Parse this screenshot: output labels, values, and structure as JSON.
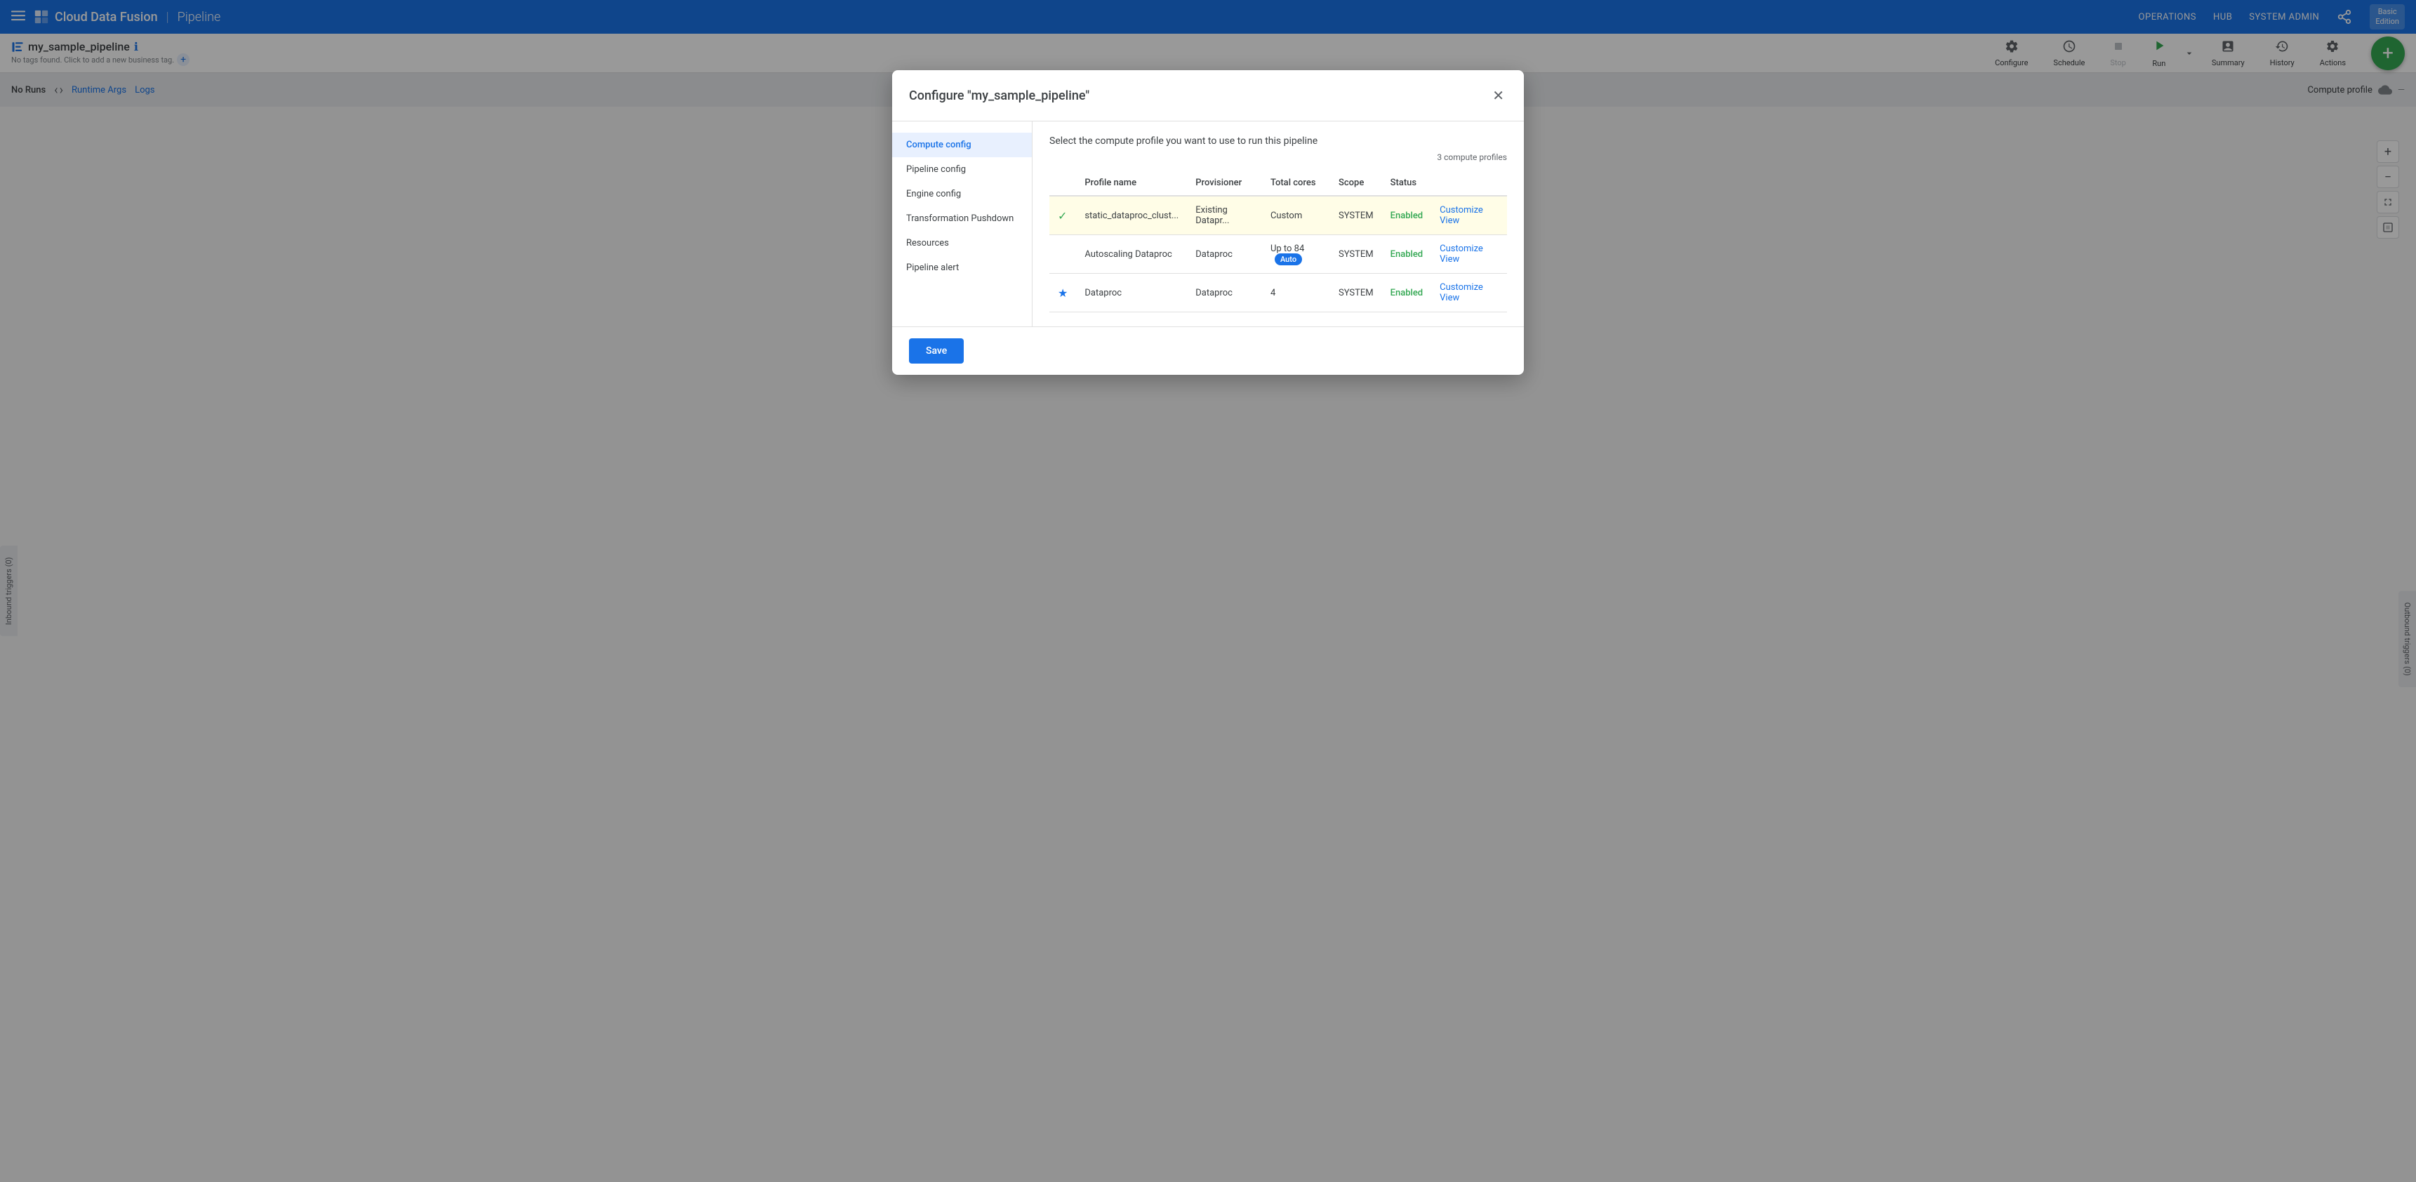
{
  "app": {
    "brand": "Cloud Data Fusion",
    "separator": "|",
    "page": "Pipeline",
    "edition": "Basic\nEdition"
  },
  "nav": {
    "operations": "OPERATIONS",
    "hub": "HUB",
    "system_admin": "SYSTEM ADMIN"
  },
  "pipeline": {
    "name": "my_sample_pipeline",
    "tags_placeholder": "No tags found. Click to add a new business tag.",
    "add_tag_icon": "+"
  },
  "toolbar": {
    "configure_label": "Configure",
    "schedule_label": "Schedule",
    "stop_label": "Stop",
    "run_label": "Run",
    "summary_label": "Summary",
    "history_label": "History",
    "actions_label": "Actions"
  },
  "run_bar": {
    "no_runs": "No Runs",
    "runtime_args": "Runtime Args",
    "logs": "Logs",
    "compute_profile": "Compute profile"
  },
  "inbound": {
    "label": "Inbound triggers (0)"
  },
  "outbound": {
    "label": "Outbound triggers (0)"
  },
  "modal": {
    "title": "Configure \"my_sample_pipeline\"",
    "close_icon": "✕",
    "sidebar_items": [
      {
        "id": "compute-config",
        "label": "Compute config",
        "active": true
      },
      {
        "id": "pipeline-config",
        "label": "Pipeline config",
        "active": false
      },
      {
        "id": "engine-config",
        "label": "Engine config",
        "active": false
      },
      {
        "id": "transformation-pushdown",
        "label": "Transformation\nPushdown",
        "active": false
      },
      {
        "id": "resources",
        "label": "Resources",
        "active": false
      },
      {
        "id": "pipeline-alert",
        "label": "Pipeline alert",
        "active": false
      }
    ],
    "content": {
      "description": "Select the compute profile you want to use to run this pipeline",
      "profile_count": "3 compute profiles",
      "table_headers": [
        "Profile name",
        "Provisioner",
        "Total cores",
        "Scope",
        "Status"
      ],
      "profiles": [
        {
          "selected": true,
          "indicator": "✓",
          "indicator_type": "check",
          "name": "static_dataproc_clust...",
          "provisioner": "Existing Datapr...",
          "total_cores": "Custom",
          "scope": "SYSTEM",
          "status": "Enabled",
          "customize_label": "Customize",
          "view_label": "View"
        },
        {
          "selected": false,
          "indicator": "",
          "indicator_type": "none",
          "name": "Autoscaling Dataproc",
          "provisioner": "Dataproc",
          "total_cores": "Up to 84",
          "auto_badge": "Auto",
          "scope": "SYSTEM",
          "status": "Enabled",
          "customize_label": "Customize",
          "view_label": "View"
        },
        {
          "selected": false,
          "indicator": "★",
          "indicator_type": "star",
          "name": "Dataproc",
          "provisioner": "Dataproc",
          "total_cores": "4",
          "scope": "SYSTEM",
          "status": "Enabled",
          "customize_label": "Customize",
          "view_label": "View"
        }
      ],
      "save_label": "Save"
    }
  }
}
